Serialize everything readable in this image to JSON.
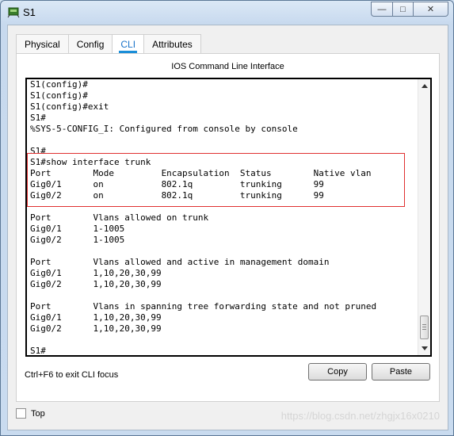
{
  "window": {
    "title": "S1"
  },
  "window_controls": {
    "minimize": "—",
    "maximize": "□",
    "close": "✕"
  },
  "tabs": [
    {
      "label": "Physical"
    },
    {
      "label": "Config"
    },
    {
      "label": "CLI"
    },
    {
      "label": "Attributes"
    }
  ],
  "active_tab": "CLI",
  "panel": {
    "title": "IOS Command Line Interface"
  },
  "console": {
    "lines": "S1(config)#\nS1(config)#\nS1(config)#exit\nS1#\n%SYS-5-CONFIG_I: Configured from console by console\n\nS1#\nS1#show interface trunk\nPort        Mode         Encapsulation  Status        Native vlan\nGig0/1      on           802.1q         trunking      99\nGig0/2      on           802.1q         trunking      99\n\nPort        Vlans allowed on trunk\nGig0/1      1-1005\nGig0/2      1-1005\n\nPort        Vlans allowed and active in management domain\nGig0/1      1,10,20,30,99\nGig0/2      1,10,20,30,99\n\nPort        Vlans in spanning tree forwarding state and not pruned\nGig0/1      1,10,20,30,99\nGig0/2      1,10,20,30,99\n\nS1#"
  },
  "footer": {
    "hint": "Ctrl+F6 to exit CLI focus",
    "copy_label": "Copy",
    "paste_label": "Paste"
  },
  "top_option": {
    "label": "Top",
    "checked": false
  },
  "watermark": "https://blog.csdn.net/zhgjx16x0210",
  "colors": {
    "highlight": "#e03030",
    "tab_accent": "#1a8ed8"
  }
}
